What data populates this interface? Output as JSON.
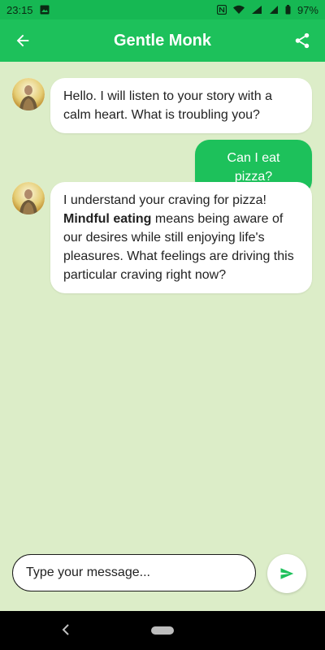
{
  "status": {
    "time": "23:15",
    "battery": "97%"
  },
  "appbar": {
    "title": "Gentle Monk",
    "back_icon": "arrow-left-icon",
    "share_icon": "share-icon"
  },
  "messages": [
    {
      "from": "monk",
      "text": "Hello. I will listen to your story with a calm heart. What is troubling you?"
    },
    {
      "from": "user",
      "text": "Can I eat pizza?"
    },
    {
      "from": "monk",
      "text_before": "I understand your craving for pizza! ",
      "bold": "Mindful eating",
      "text_after": " means being aware of our desires while still enjoying life's pleasures. What feelings are driving this particular craving right now?"
    }
  ],
  "composer": {
    "placeholder": "Type your message...",
    "send_icon": "send-icon"
  },
  "colors": {
    "accent": "#1dc15b",
    "background": "#dcedc8",
    "bubble": "#ffffff"
  }
}
